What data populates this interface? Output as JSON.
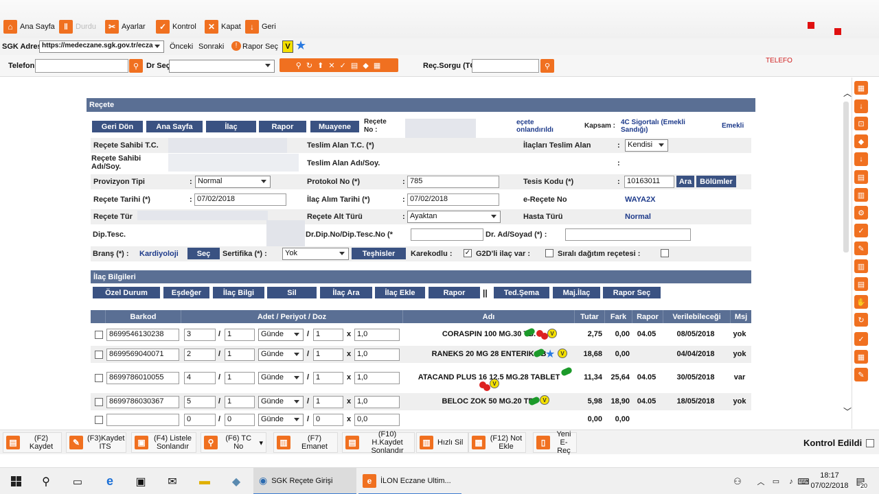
{
  "toolbar": {
    "home": "Ana Sayfa",
    "stopped": "Durdu",
    "settings": "Ayarlar",
    "control": "Kontrol",
    "close": "Kapat",
    "back": "Geri"
  },
  "address": {
    "label": "SGK Adres",
    "url": "https://medeczane.sgk.gov.tr/ecza",
    "prev": "Önceki",
    "next": "Sonraki",
    "report_select": "Rapor Seç",
    "v_badge": "V"
  },
  "phonebar": {
    "phone_label": "Telefon",
    "doctor_label": "Dr Seç",
    "rec_query_label": "Reç.Sorgu (TC)",
    "phone_tag": "TELEFO"
  },
  "recete": {
    "title": "Reçete",
    "nav": [
      "Geri Dön",
      "Ana Sayfa",
      "İlaç",
      "Rapor",
      "Muayene"
    ],
    "recete_no_label": "Reçete No :",
    "status_text": "eçete onlandırıldı",
    "kapsam_label": "Kapsam :",
    "kapsam_value": "4C Sigortalı (Emekli Sandığı)",
    "emekli": "Emekli",
    "owner_tc": "Reçete Sahibi T.C.",
    "owner_name": "Reçete Sahibi Adı/Soy.",
    "recv_tc": "Teslim Alan T.C. (*)",
    "recv_name": "Teslim Alan Adı/Soy.",
    "drugs_recv_label": "İlaçları Teslim Alan",
    "drugs_recv_value": "Kendisi",
    "prov_label": "Provizyon Tipi",
    "prov_value": "Normal",
    "protocol_label": "Protokol No (*)",
    "protocol_value": "785",
    "facility_label": "Tesis Kodu (*)",
    "facility_value": "10163011",
    "search_btn": "Ara",
    "dept_btn": "Bölümler",
    "date_label": "Reçete Tarihi (*)",
    "date_value": "07/02/2018",
    "buy_date_label": "İlaç Alım Tarihi (*)",
    "buy_date_value": "07/02/2018",
    "erecete_label": "e-Reçete No",
    "erecete_value": "WAYA2X",
    "type_label": "Reçete Tür",
    "subtype_label": "Reçete Alt Türü",
    "subtype_value": "Ayaktan",
    "patient_type_label": "Hasta Türü",
    "patient_type_value": "Normal",
    "dip_label": "Dip.Tesc.",
    "drdip_label": "Dr.Dip.No/Dip.Tesc.No (*",
    "drname_label": "Dr. Ad/Soyad (*) :",
    "branch_label": "Branş (*) :",
    "branch_value": "Kardiyoloji",
    "select_btn": "Seç",
    "cert_label": "Sertifika (*) :",
    "cert_value": "Yok",
    "diag_btn": "Teşhisler",
    "barcode_label": "Karekodlu :",
    "g2d_label": "G2D'li ilaç var :",
    "ordered_label": "Sıralı dağıtım reçetesi :"
  },
  "drugs": {
    "title": "İlaç Bilgileri",
    "buttons": [
      "Özel Durum",
      "Eşdeğer",
      "İlaç Bilgi",
      "Sil",
      "İlaç Ara",
      "İlaç Ekle",
      "Rapor",
      "Ted.Şema",
      "Maj.İlaç",
      "Rapor Seç"
    ],
    "sep": "||",
    "headers": {
      "barcode": "Barkod",
      "dose": "Adet / Periyot / Doz",
      "name": "Adı",
      "price": "Tutar",
      "diff": "Fark",
      "report": "Rapor",
      "giveable": "Verilebileceği",
      "msg": "Msj"
    },
    "rows": [
      {
        "barcode": "8699546130238",
        "qty": "3",
        "period": "1",
        "unit": "Günde",
        "times": "1",
        "dose": "1,0",
        "name": "CORASPIN 100 MG.30 TB.",
        "price": "2,75",
        "diff": "0,00",
        "report": "04.05",
        "date": "08/05/2018",
        "msg": "yok"
      },
      {
        "barcode": "8699569040071",
        "qty": "2",
        "period": "1",
        "unit": "Günde",
        "times": "1",
        "dose": "1,0",
        "name": "RANEKS 20 MG 28 ENTERIK TB",
        "price": "18,68",
        "diff": "0,00",
        "report": "",
        "date": "04/04/2018",
        "msg": "yok"
      },
      {
        "barcode": "8699786010055",
        "qty": "4",
        "period": "1",
        "unit": "Günde",
        "times": "1",
        "dose": "1,0",
        "name": "ATACAND PLUS 16 12.5 MG.28 TABLET",
        "price": "11,34",
        "diff": "25,64",
        "report": "04.05",
        "date": "30/05/2018",
        "msg": "var"
      },
      {
        "barcode": "8699786030367",
        "qty": "5",
        "period": "1",
        "unit": "Günde",
        "times": "1",
        "dose": "1,0",
        "name": "BELOC ZOK 50 MG.20 TB.",
        "price": "5,98",
        "diff": "18,90",
        "report": "04.05",
        "date": "18/05/2018",
        "msg": "yok"
      },
      {
        "barcode": "",
        "qty": "0",
        "period": "0",
        "unit": "Günde",
        "times": "0",
        "dose": "0,0",
        "name": "",
        "price": "0,00",
        "diff": "0,00",
        "report": "",
        "date": "",
        "msg": ""
      }
    ],
    "sep_slash": "/",
    "x": "x"
  },
  "fnbar": {
    "f2": "(F2) Kaydet",
    "f3": "(F3)Kaydet ITS",
    "f4": "(F4) Listele Sonlandır",
    "f6": "(F6) TC No",
    "f7": "(F7) Emanet",
    "f10": "(F10) H.Kaydet Sonlandır",
    "quick": "Hızlı Sil",
    "f12": "(F12) Not Ekle",
    "new": "Yeni E-Reç",
    "checked": "Kontrol Edildi"
  },
  "taskbar": {
    "app1": "SGK Reçete Girişi",
    "app2": "İLON Eczane Ultim...",
    "time": "18:17",
    "date": "07/02/2018",
    "badge": "20"
  },
  "colors": {
    "accent": "#f07020",
    "header": "#5a6f94",
    "button": "#3a5282",
    "link": "#1d3a8a"
  }
}
